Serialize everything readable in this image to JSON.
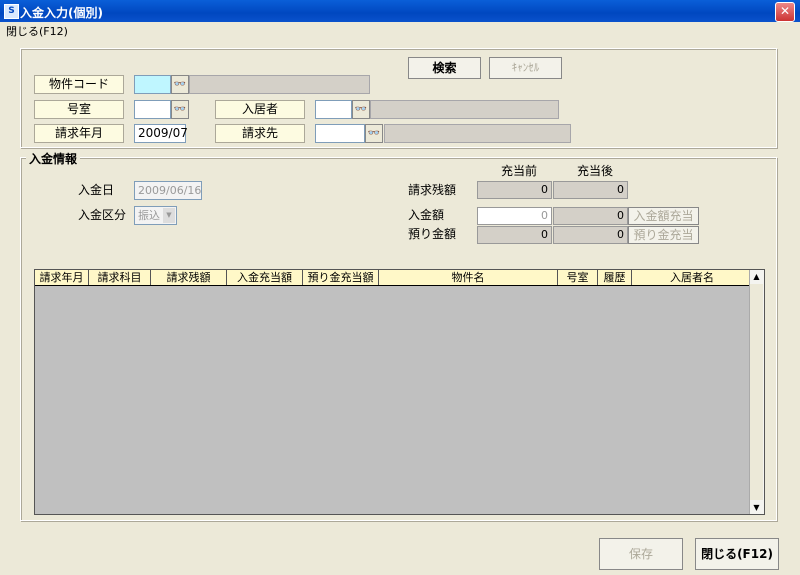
{
  "window": {
    "title": "入金入力(個別)",
    "app_icon": "S",
    "close_glyph": "✕"
  },
  "menu": {
    "close_label": "閉じる(F12)"
  },
  "search": {
    "property_code_label": "物件コード",
    "property_code_value": "",
    "room_label": "号室",
    "room_value": "",
    "tenant_label": "入居者",
    "tenant_value": "",
    "billing_month_label": "請求年月",
    "billing_month_value": "2009/07",
    "billing_target_label": "請求先",
    "billing_target_value": "",
    "search_button": "検索",
    "cancel_button": "ｷｬﾝｾﾙ"
  },
  "payment": {
    "section_title": "入金情報",
    "date_label": "入金日",
    "date_value": "2009/06/16",
    "type_label": "入金区分",
    "type_value": "振込",
    "col_before": "充当前",
    "col_after": "充当後",
    "balance_label": "請求残額",
    "balance_before": "0",
    "balance_after": "0",
    "amount_label": "入金額",
    "amount_before": "0",
    "amount_after": "0",
    "amount_apply_button": "入金額充当",
    "deposit_label": "預り金額",
    "deposit_before": "0",
    "deposit_after": "0",
    "deposit_apply_button": "預り金充当"
  },
  "grid": {
    "columns": [
      "請求年月",
      "請求科目",
      "請求残額",
      "入金充当額",
      "預り金充当額",
      "物件名",
      "号室",
      "履歴",
      "入居者名"
    ],
    "rows": []
  },
  "footer": {
    "save_button": "保存",
    "close_button": "閉じる(F12)"
  },
  "colors": {
    "titlebar": "#0047c0",
    "label_bg": "#fdfbe1",
    "highlight_input": "#bff6ff",
    "window_bg": "#ece9d8"
  }
}
